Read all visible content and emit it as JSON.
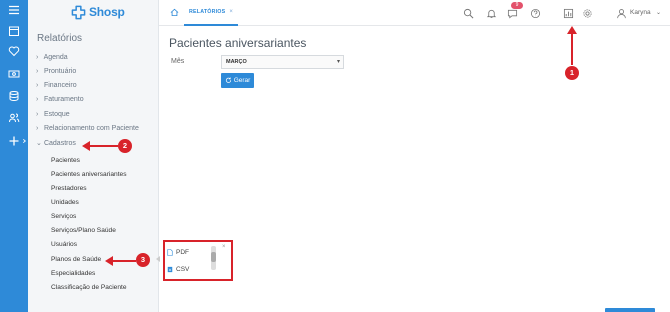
{
  "app": {
    "logo_text": "Shosp",
    "brand_color": "#2e8ad8"
  },
  "topbar": {
    "tab_label": "RELATÓRIOS",
    "tab_close": "×",
    "notification_count": "9",
    "user_name": "Karyna",
    "icons": [
      "home-icon",
      "search-icon",
      "bell-icon",
      "chat-icon",
      "help-icon",
      "reports-icon",
      "gear-icon",
      "user-icon"
    ]
  },
  "sidebar": {
    "title": "Relatórios",
    "menu": [
      {
        "label": "Agenda",
        "chev": "›"
      },
      {
        "label": "Prontuário",
        "chev": "›"
      },
      {
        "label": "Financeiro",
        "chev": "›"
      },
      {
        "label": "Faturamento",
        "chev": "›"
      },
      {
        "label": "Estoque",
        "chev": "›"
      },
      {
        "label": "Relacionamento com Paciente",
        "chev": "›"
      },
      {
        "label": "Cadastros",
        "chev": "⌄"
      }
    ],
    "cadastros_items": [
      "Pacientes",
      "Pacientes aniversariantes",
      "Prestadores",
      "Unidades",
      "Serviços",
      "Serviços/Plano Saúde",
      "Usuários",
      "Planos de Saúde",
      "Especialidades",
      "Classificação de Paciente"
    ]
  },
  "main": {
    "title": "Pacientes aniversariantes",
    "mes_label": "Mês",
    "mes_value": "MARÇO",
    "gerar_label": "Gerar"
  },
  "export_menu": {
    "options": [
      "PDF",
      "CSV"
    ],
    "close": "×"
  },
  "markers": [
    "1",
    "2",
    "3"
  ],
  "colors": {
    "annotation_red": "#d8232a",
    "badge": "#e3526b"
  }
}
